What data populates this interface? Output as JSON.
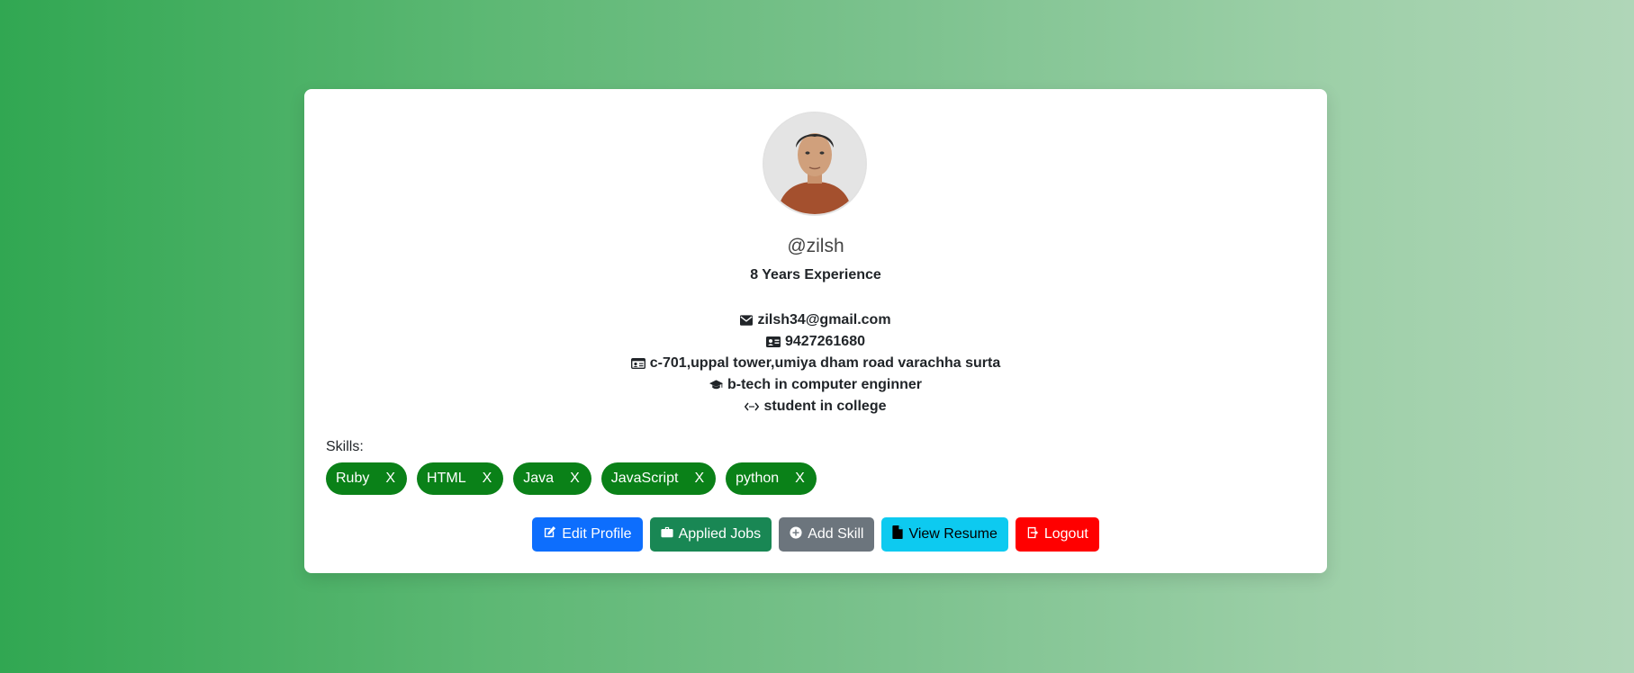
{
  "profile": {
    "username": "@zilsh",
    "experience": "8 Years Experience",
    "email": "zilsh34@gmail.com",
    "phone": "9427261680",
    "address": "c-701,uppal tower,umiya dham road varachha surta",
    "education": "b-tech in computer enginner",
    "status": "student in college"
  },
  "skills": {
    "label": "Skills:",
    "remove_label": "X",
    "items": [
      "Ruby",
      "HTML",
      "Java",
      "JavaScript",
      "python"
    ]
  },
  "actions": {
    "edit": "Edit Profile",
    "applied": "Applied Jobs",
    "add_skill": "Add Skill",
    "resume": "View Resume",
    "logout": "Logout"
  },
  "colors": {
    "skill_pill": "#0a8118",
    "edit": "#0d6efd",
    "applied": "#198754",
    "add_skill": "#6c757d",
    "resume": "#0dcaf0",
    "logout": "#ff0000"
  },
  "icons": {
    "email": "envelope-icon",
    "phone": "person-vcard-icon",
    "address": "id-card-icon",
    "education": "mortarboard-icon",
    "status": "code-arrows-icon",
    "edit": "pencil-square-icon",
    "applied": "briefcase-icon",
    "add_skill": "plus-circle-icon",
    "resume": "file-icon",
    "logout": "box-arrow-right-icon"
  }
}
